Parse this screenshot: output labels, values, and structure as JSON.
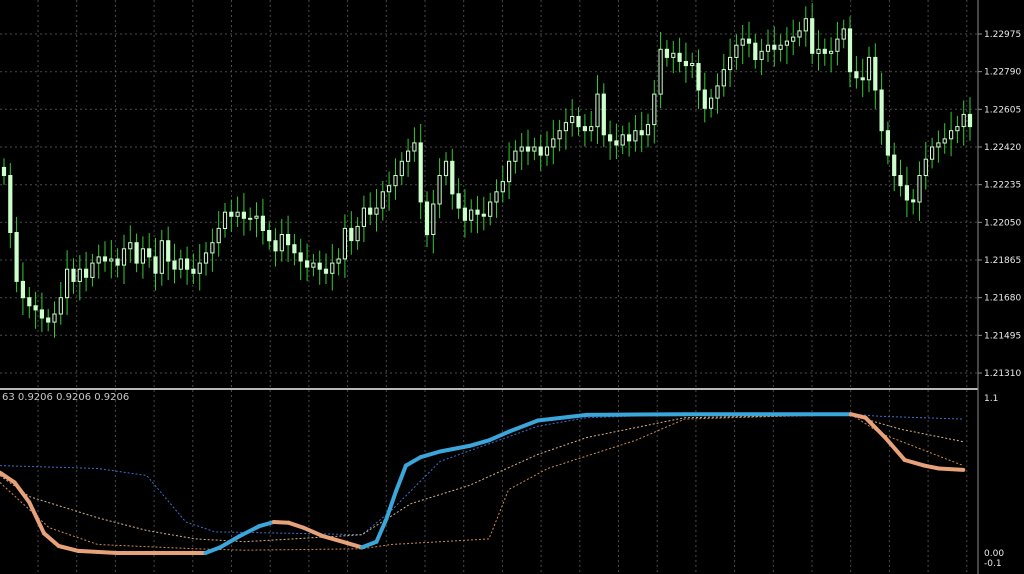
{
  "indicator_header": "63 0.9206 0.9206 0.9206",
  "colors": {
    "background": "#000000",
    "grid": "#4a4a4a",
    "candle_up": "#ccffcc",
    "candle_down": "#ccffcc",
    "wick": "#33cc33",
    "main_line_up": "#3aa6d9",
    "main_line_down": "#e8a27a",
    "main_line_neutral": "#bbbbbb",
    "separator": "#b8b8b8",
    "axis_text": "#e8e8e8"
  },
  "chart_data": [
    {
      "type": "candlestick",
      "title": "",
      "ylim": [
        1.2113,
        1.2316
      ],
      "y_ticks": [
        "1.22975",
        "1.22790",
        "1.22605",
        "1.22420",
        "1.22235",
        "1.22050",
        "1.21865",
        "1.21680",
        "1.21495",
        "1.21310"
      ],
      "y_tick_values": [
        1.22975,
        1.2279,
        1.22605,
        1.2242,
        1.22235,
        1.2205,
        1.21865,
        1.2168,
        1.21495,
        1.2131
      ],
      "close_series": [
        1.2228,
        1.22,
        1.2176,
        1.2168,
        1.2164,
        1.2162,
        1.2158,
        1.2156,
        1.216,
        1.2168,
        1.2182,
        1.2176,
        1.2182,
        1.2178,
        1.2185,
        1.2188,
        1.2186,
        1.2187,
        1.2184,
        1.2192,
        1.2195,
        1.2185,
        1.2192,
        1.2188,
        1.218,
        1.2196,
        1.2186,
        1.2182,
        1.2187,
        1.2182,
        1.218,
        1.2185,
        1.219,
        1.2195,
        1.2202,
        1.221,
        1.2208,
        1.221,
        1.2207,
        1.2207,
        1.2208,
        1.2201,
        1.2196,
        1.2191,
        1.2199,
        1.2194,
        1.219,
        1.2186,
        1.2183,
        1.2185,
        1.2182,
        1.218,
        1.2185,
        1.2187,
        1.2202,
        1.2196,
        1.2203,
        1.2212,
        1.2209,
        1.2212,
        1.222,
        1.2223,
        1.2228,
        1.2235,
        1.224,
        1.2244,
        1.2215,
        1.2199,
        1.2214,
        1.2228,
        1.2235,
        1.2219,
        1.2212,
        1.2206,
        1.2211,
        1.2209,
        1.2208,
        1.2215,
        1.222,
        1.2225,
        1.2235,
        1.224,
        1.2242,
        1.224,
        1.2242,
        1.2238,
        1.2242,
        1.2246,
        1.225,
        1.2254,
        1.2257,
        1.2252,
        1.225,
        1.2252,
        1.2268,
        1.2248,
        1.2245,
        1.2243,
        1.2248,
        1.2245,
        1.225,
        1.2248,
        1.2253,
        1.2268,
        1.229,
        1.2286,
        1.2288,
        1.2284,
        1.2282,
        1.2283,
        1.227,
        1.2261,
        1.2266,
        1.2272,
        1.228,
        1.2286,
        1.2292,
        1.2295,
        1.2293,
        1.2285,
        1.2289,
        1.2292,
        1.229,
        1.2292,
        1.2294,
        1.2296,
        1.2299,
        1.2305,
        1.2288,
        1.229,
        1.2288,
        1.2289,
        1.2295,
        1.23,
        1.2279,
        1.2276,
        1.2275,
        1.2286,
        1.227,
        1.225,
        1.2238,
        1.2228,
        1.2223,
        1.2216,
        1.2215,
        1.2228,
        1.2236,
        1.2242,
        1.2244,
        1.2246,
        1.225,
        1.2252,
        1.2258,
        1.2252
      ]
    },
    {
      "type": "line",
      "title": "",
      "ylim": [
        -0.1,
        1.1
      ],
      "y_ticks": [
        "1.1",
        "0.00",
        "-0.1"
      ],
      "y_tick_values": [
        1.1,
        0.0,
        -0.1
      ],
      "main_line": [
        [
          0,
          0.57
        ],
        [
          0.015,
          0.5
        ],
        [
          0.03,
          0.36
        ],
        [
          0.045,
          0.14
        ],
        [
          0.06,
          0.05
        ],
        [
          0.08,
          0.015
        ],
        [
          0.12,
          0.0
        ],
        [
          0.2,
          0.0
        ],
        [
          0.21,
          0.0
        ],
        [
          0.225,
          0.04
        ],
        [
          0.245,
          0.12
        ],
        [
          0.265,
          0.19
        ],
        [
          0.28,
          0.22
        ],
        [
          0.295,
          0.215
        ],
        [
          0.31,
          0.18
        ],
        [
          0.33,
          0.12
        ],
        [
          0.355,
          0.07
        ],
        [
          0.37,
          0.04
        ],
        [
          0.385,
          0.08
        ],
        [
          0.395,
          0.24
        ],
        [
          0.405,
          0.44
        ],
        [
          0.415,
          0.62
        ],
        [
          0.43,
          0.68
        ],
        [
          0.45,
          0.72
        ],
        [
          0.48,
          0.76
        ],
        [
          0.5,
          0.8
        ],
        [
          0.52,
          0.86
        ],
        [
          0.55,
          0.94
        ],
        [
          0.6,
          0.98
        ],
        [
          0.7,
          0.985
        ],
        [
          0.87,
          0.985
        ],
        [
          0.885,
          0.96
        ],
        [
          0.905,
          0.82
        ],
        [
          0.925,
          0.66
        ],
        [
          0.945,
          0.62
        ],
        [
          0.96,
          0.6
        ],
        [
          0.985,
          0.59
        ]
      ],
      "aux_lines": [
        [
          [
            0,
            0.62
          ],
          [
            0.1,
            0.6
          ],
          [
            0.15,
            0.55
          ],
          [
            0.19,
            0.22
          ],
          [
            0.22,
            0.15
          ],
          [
            0.3,
            0.14
          ],
          [
            0.37,
            0.13
          ],
          [
            0.4,
            0.3
          ],
          [
            0.45,
            0.65
          ],
          [
            0.55,
            0.9
          ],
          [
            0.6,
            0.96
          ],
          [
            0.7,
            0.985
          ],
          [
            0.87,
            0.985
          ],
          [
            0.9,
            0.97
          ],
          [
            0.985,
            0.95
          ]
        ],
        [
          [
            0,
            0.55
          ],
          [
            0.03,
            0.4
          ],
          [
            0.1,
            0.25
          ],
          [
            0.15,
            0.16
          ],
          [
            0.2,
            0.1
          ],
          [
            0.25,
            0.08
          ],
          [
            0.3,
            0.1
          ],
          [
            0.37,
            0.13
          ],
          [
            0.42,
            0.35
          ],
          [
            0.48,
            0.48
          ],
          [
            0.55,
            0.7
          ],
          [
            0.6,
            0.82
          ],
          [
            0.7,
            0.96
          ],
          [
            0.87,
            0.98
          ],
          [
            0.92,
            0.88
          ],
          [
            0.985,
            0.79
          ]
        ],
        [
          [
            0,
            0.5
          ],
          [
            0.05,
            0.18
          ],
          [
            0.1,
            0.06
          ],
          [
            0.2,
            0.03
          ],
          [
            0.25,
            0.02
          ],
          [
            0.37,
            0.03
          ],
          [
            0.4,
            0.06
          ],
          [
            0.5,
            0.1
          ],
          [
            0.52,
            0.45
          ],
          [
            0.56,
            0.6
          ],
          [
            0.65,
            0.8
          ],
          [
            0.7,
            0.95
          ],
          [
            0.87,
            0.985
          ],
          [
            0.9,
            0.85
          ],
          [
            0.985,
            0.62
          ]
        ]
      ]
    }
  ]
}
